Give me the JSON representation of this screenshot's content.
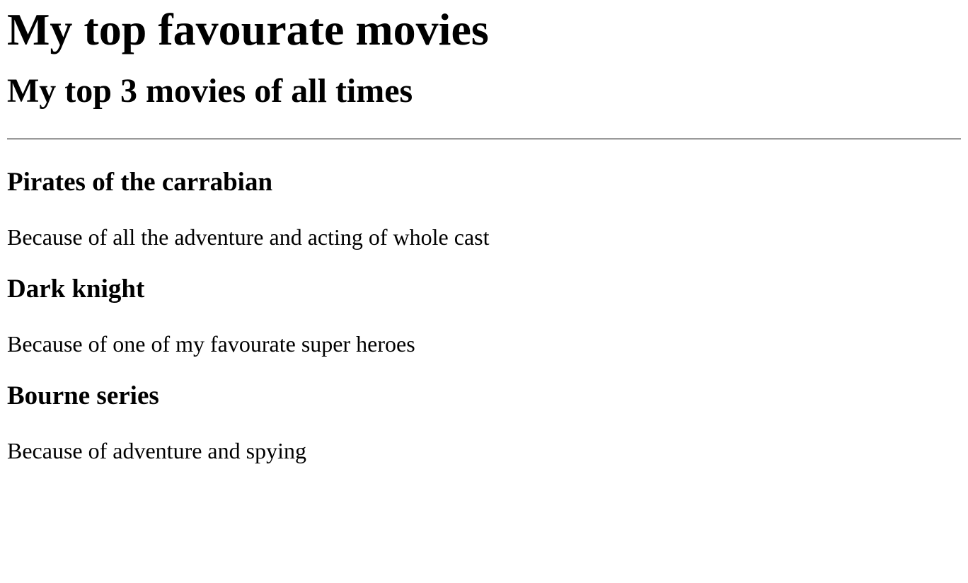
{
  "page": {
    "title": "My top favourate movies",
    "subtitle": "My top 3 movies of all times"
  },
  "movies": [
    {
      "title": "Pirates of the carrabian",
      "reason": "Because of all the adventure and acting of whole cast"
    },
    {
      "title": "Dark knight",
      "reason": "Because of one of my favourate super heroes"
    },
    {
      "title": "Bourne series",
      "reason": "Because of adventure and spying"
    }
  ]
}
